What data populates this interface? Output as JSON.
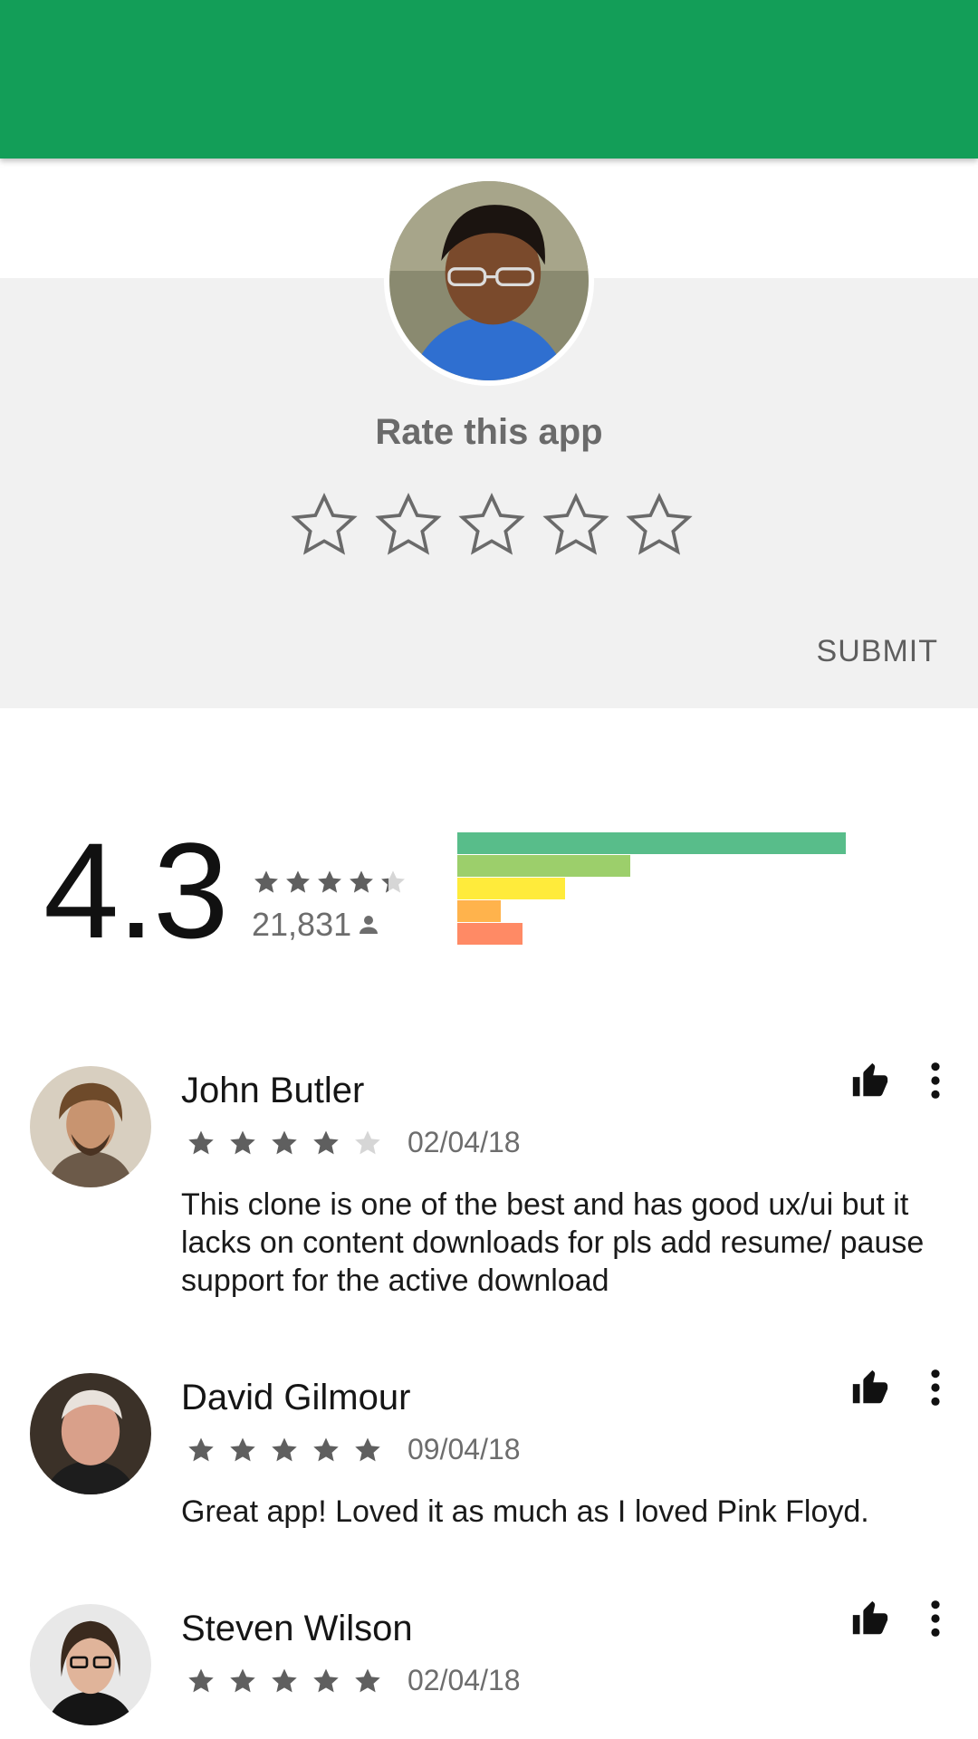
{
  "colors": {
    "appbar": "#139e58",
    "panel": "#f1f1f1",
    "star_filled": "#5f5f5f",
    "star_empty": "#d6d6d6",
    "bar_5": "#58bd8a",
    "bar_4": "#9ccf6b",
    "bar_3": "#ffeb3b",
    "bar_2": "#ffb34c",
    "bar_1": "#ff8a65"
  },
  "rate": {
    "avatar_icon": "user-avatar",
    "title": "Rate this app",
    "star_count": 5,
    "submit_label": "SUBMIT"
  },
  "summary": {
    "score": "4.3",
    "rating_value": 4.3,
    "count": "21,831",
    "count_icon": "person-icon",
    "distribution": [
      {
        "stars": 5,
        "fraction": 0.81
      },
      {
        "stars": 4,
        "fraction": 0.36
      },
      {
        "stars": 3,
        "fraction": 0.225
      },
      {
        "stars": 2,
        "fraction": 0.09
      },
      {
        "stars": 1,
        "fraction": 0.135
      }
    ]
  },
  "reviews": [
    {
      "name": "John Butler",
      "rating": 4,
      "date": "02/04/18",
      "text": "This clone is one of the best and has good ux/ui but it lacks on content downloads for pls add resume/ pause support for the active download"
    },
    {
      "name": "David Gilmour",
      "rating": 5,
      "date": "09/04/18",
      "text": "Great app! Loved it as much as I loved Pink Floyd."
    },
    {
      "name": "Steven Wilson",
      "rating": 5,
      "date": "02/04/18",
      "text": ""
    }
  ]
}
